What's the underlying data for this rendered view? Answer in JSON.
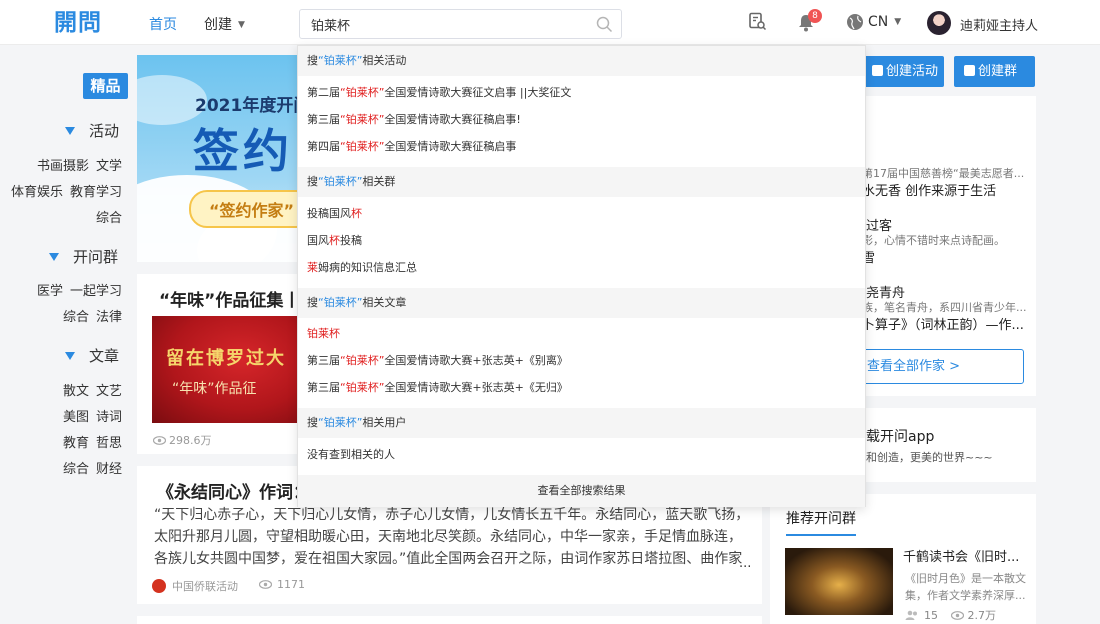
{
  "header": {
    "logo": "開問",
    "nav_home": "首页",
    "nav_create": "创建",
    "search_value": "铂莱杯",
    "notification_count": "8",
    "language": "CN",
    "username": "迪莉娅主持人"
  },
  "sidebar": {
    "featured": "精品",
    "sections": [
      {
        "title": "活动",
        "rows": [
          [
            "书画摄影",
            "文学"
          ],
          [
            "体育娱乐",
            "教育学习"
          ],
          [
            "综合"
          ]
        ]
      },
      {
        "title": "开问群",
        "rows": [
          [
            "医学",
            "一起学习"
          ],
          [
            "综合",
            "法律"
          ]
        ]
      },
      {
        "title": "文章",
        "rows": [
          [
            "散文",
            "文艺"
          ],
          [
            "美图",
            "诗词"
          ],
          [
            "教育",
            "哲思"
          ],
          [
            "综合",
            "财经"
          ]
        ]
      }
    ]
  },
  "banner": {
    "year_text": "2021年度开问",
    "big_text": "签约",
    "pill_text": "“签约作家”"
  },
  "cards": {
    "card1_title": "“年味”作品征集丨",
    "card1_image_text1": "留在博罗过大",
    "card1_image_text2": "“年味”作品征",
    "card1_views": "298.6万",
    "card2_title": "《永结同心》作词：",
    "card2_body": "“天下归心赤子心，天下归心儿女情，赤子心儿女情，儿女情长五千年。永结同心，蓝天歌飞扬，太阳升那月儿圆，守望相助暖心田，天南地北尽笑颜。永结同心，中华一家亲，手足情血脉连，各族儿女共圆中国梦，爱在祖国大家园。”值此全国两会召开之际，由词作家苏日塔拉图、曲作家方珲共",
    "card2_more": "...",
    "card2_org": "中国侨联活动",
    "card2_views": "1171"
  },
  "right": {
    "btn_create_activity": "创建活动",
    "btn_create_group": "创建群",
    "writer1_line1": "第17届中国慈善榜“最美志愿者...",
    "writer1_line2": "水无香 创作来源于生活",
    "writer2_name": "过客",
    "writer2_line1": "影，心情不错时来点诗配画。",
    "writer2_line2": "雪",
    "writer3_name": "尧青舟",
    "writer3_line1": "族，笔名青舟，系四川省青少年...",
    "writer3_line2": "卜算子》（词林正韵）—作...",
    "view_all_writers": "查看全部作家 >",
    "app_title": "载开问app",
    "app_sub": "和创造，更美的世界~~~",
    "groups_tab": "推荐开问群",
    "group_name": "千鹤读书会《旧时...",
    "group_desc1": "《旧时月色》是一本散文",
    "group_desc2": "集，作者文学素养深厚...",
    "group_members": "15",
    "group_views": "2.7万"
  },
  "dropdown": {
    "sections": [
      {
        "prefix": "搜",
        "keyword": "“铂莱杯”",
        "suffix": "相关活动",
        "items": [
          {
            "pre": "第二届",
            "kw": "“铂莱杯”",
            "post": "全国爱情诗歌大赛征文启事 ||大奖征文"
          },
          {
            "pre": "第三届",
            "kw": "“铂莱杯”",
            "post": "全国爱情诗歌大赛征稿启事!"
          },
          {
            "pre": "第四届",
            "kw": "“铂莱杯”",
            "post": "全国爱情诗歌大赛征稿启事"
          }
        ]
      },
      {
        "prefix": "搜",
        "keyword": "“铂莱杯”",
        "suffix": "相关群",
        "items": [
          {
            "pre": "投稿国风",
            "kw": "杯",
            "post": ""
          },
          {
            "pre": "国风",
            "kw": "杯",
            "post": "投稿"
          },
          {
            "pre": "",
            "kw": "莱",
            "post": "姆病的知识信息汇总"
          }
        ]
      },
      {
        "prefix": "搜",
        "keyword": "“铂莱杯”",
        "suffix": "相关文章",
        "items": [
          {
            "pre": "",
            "kw": "铂莱杯",
            "post": ""
          },
          {
            "pre": "第三届",
            "kw": "“铂莱杯”",
            "post": "全国爱情诗歌大赛+张志英+《别离》"
          },
          {
            "pre": "第三届",
            "kw": "“铂莱杯”",
            "post": "全国爱情诗歌大赛+张志英+《无归》"
          }
        ]
      },
      {
        "prefix": "搜",
        "keyword": "“铂莱杯”",
        "suffix": "相关用户",
        "items": [
          {
            "pre": "没有查到相关的人",
            "kw": "",
            "post": ""
          }
        ]
      }
    ],
    "footer": "查看全部搜索结果"
  }
}
